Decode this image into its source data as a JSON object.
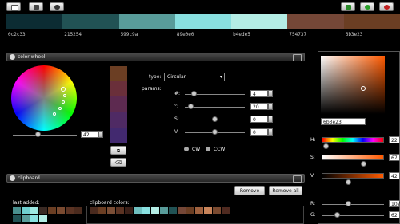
{
  "toolbar": {
    "left_icons": [
      "new-doc-icon",
      "open-folder-icon",
      "share-icon"
    ],
    "right_icons": [
      "back-arrow-icon",
      "add-icon",
      "close-icon"
    ]
  },
  "palette": [
    {
      "hex": "0c2c33",
      "color": "#0c2c33"
    },
    {
      "hex": "215254",
      "color": "#215254"
    },
    {
      "hex": "599c9a",
      "color": "#599c9a"
    },
    {
      "hex": "89e0e0",
      "color": "#89e0e0"
    },
    {
      "hex": "b4ede5",
      "color": "#b4ede5"
    },
    {
      "hex": "754737",
      "color": "#754737"
    },
    {
      "hex": "6b3e23",
      "color": "#6b3e23"
    }
  ],
  "color_wheel": {
    "title": "color wheel",
    "angle_value": "42",
    "type_label": "type:",
    "type_value": "Circular",
    "params_label": "params:",
    "params": [
      {
        "label": "#:",
        "value": "4",
        "pos": 0.1
      },
      {
        "label": "°:",
        "value": "20",
        "pos": 0.05
      },
      {
        "label": "S:",
        "value": "0",
        "pos": 0.45
      },
      {
        "label": "V:",
        "value": "0",
        "pos": 0.45
      }
    ],
    "cw_label": "CW",
    "ccw_label": "CCW",
    "strip_colors": [
      "#6b3e23",
      "#6a2f3a",
      "#5d2a50",
      "#4f2a64",
      "#42296f"
    ]
  },
  "clipboard": {
    "title": "clipboard",
    "remove_label": "Remove",
    "remove_all_label": "Remove all",
    "last_added_label": "last added:",
    "clipboard_colors_label": "clipboard colors:",
    "last_added_row1": [
      "#4a8f8e",
      "#6fcfcf",
      "#9ee8e2",
      "#3a2a24",
      "#6b3e23",
      "#7a4a30",
      "#5b3323",
      "#4b2b1e"
    ],
    "last_added_row2": [
      "#215254",
      "#599c9a",
      "#89e0e0",
      "#b4ede5"
    ],
    "clipboard_row": [
      "#4a2a1e",
      "#6b3e23",
      "#7a4e36",
      "#5b3323",
      "#3a1f18",
      "#6fbfbf",
      "#89e0e0",
      "#b4ede5",
      "#599c9a",
      "#215254",
      "#754737",
      "#6b3e23",
      "#a0623f",
      "#c8845a",
      "#7a4a30",
      "#4f2a20"
    ]
  },
  "picker": {
    "hex_value": "6b3e23",
    "h_label": "H:",
    "h_value": "22",
    "h_pos": 0.06,
    "s_label": "S:",
    "s_value": "67",
    "s_pos": 0.67,
    "v_label": "V:",
    "v_value": "42",
    "v_pos": 0.42,
    "r_label": "R:",
    "r_value": "107",
    "g_label": "G:",
    "g_value": "62"
  }
}
